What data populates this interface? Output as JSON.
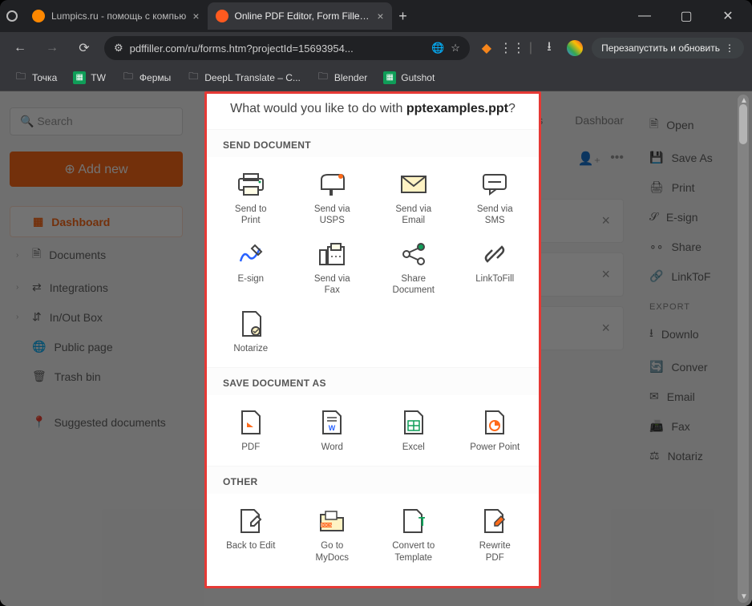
{
  "browser": {
    "tabs": [
      {
        "title": "Lumpics.ru - помощь с компью",
        "favicon_color": "#ff8800",
        "active": false
      },
      {
        "title": "Online PDF Editor, Form Filler, a",
        "favicon_color": "#ff5a1f",
        "active": true
      }
    ],
    "url": "pdffiller.com/ru/forms.htm?projectId=15693954...",
    "restart_label": "Перезапустить и обновить",
    "bookmarks": [
      {
        "label": "Точка",
        "icon": "folder"
      },
      {
        "label": "TW",
        "icon": "green"
      },
      {
        "label": "Фермы",
        "icon": "folder"
      },
      {
        "label": "DeepL Translate – C...",
        "icon": "folder"
      },
      {
        "label": "Blender",
        "icon": "folder"
      },
      {
        "label": "Gutshot",
        "icon": "green"
      }
    ]
  },
  "bg": {
    "search_placeholder": "Search",
    "add_new": "Add new",
    "nav": {
      "dashboard": "Dashboard",
      "documents": "Documents",
      "integrations": "Integrations",
      "inout": "In/Out Box",
      "public": "Public page",
      "trash": "Trash bin",
      "suggested": "Suggested documents"
    },
    "header_templates": "plates",
    "header_dashboard": "Dashboar",
    "right": {
      "open": "Open",
      "saveas": "Save As",
      "print": "Print",
      "esign": "E-sign",
      "share": "Share",
      "linktofill": "LinkToF",
      "export_head": "EXPORT",
      "download": "Downlo",
      "convert": "Conver",
      "email": "Email",
      "fax": "Fax",
      "notarize": "Notariz"
    }
  },
  "modal": {
    "title_prefix": "What would you like to do with ",
    "filename": "pptexamples.ppt",
    "title_suffix": "?",
    "sections": {
      "send": "SEND DOCUMENT",
      "save": "SAVE DOCUMENT AS",
      "other": "OTHER"
    },
    "actions": {
      "send_print": "Send to\nPrint",
      "send_usps": "Send via\nUSPS",
      "send_email": "Send via\nEmail",
      "send_sms": "Send via\nSMS",
      "esign": "E-sign",
      "send_fax": "Send via\nFax",
      "share_doc": "Share\nDocument",
      "linktofill": "LinkToFill",
      "notarize": "Notarize",
      "pdf": "PDF",
      "word": "Word",
      "excel": "Excel",
      "ppt": "Power Point",
      "back_edit": "Back to Edit",
      "goto_mydocs": "Go to\nMyDocs",
      "convert_tmpl": "Convert to\nTemplate",
      "rewrite_pdf": "Rewrite\nPDF"
    }
  },
  "colors": {
    "accent": "#ff6b1a",
    "highlight_border": "#e53935",
    "icon_orange": "#ff6b1a",
    "icon_yellow": "#f4b400",
    "icon_green": "#0f9d58"
  }
}
